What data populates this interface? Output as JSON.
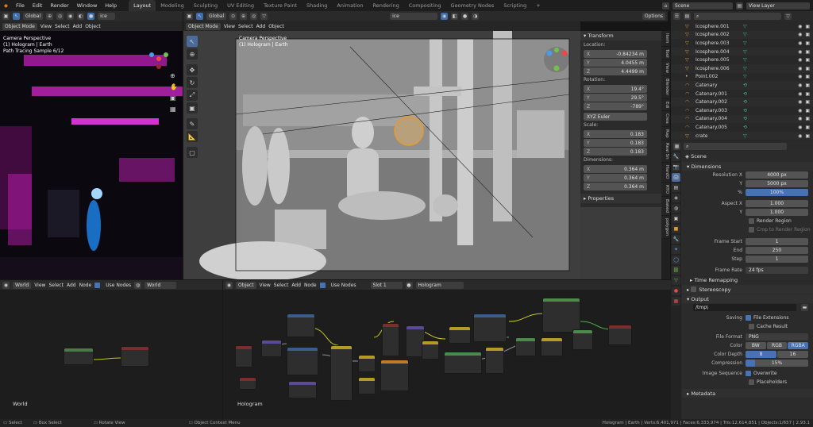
{
  "menu": [
    "File",
    "Edit",
    "Render",
    "Window",
    "Help"
  ],
  "workspaces": [
    "Layout",
    "Modeling",
    "Sculpting",
    "UV Editing",
    "Texture Paint",
    "Shading",
    "Animation",
    "Rendering",
    "Compositing",
    "Geometry Nodes",
    "Scripting"
  ],
  "active_workspace": "Layout",
  "scene_name": "Scene",
  "view_layer": "View Layer",
  "left_viewport": {
    "mode": "Object Mode",
    "menus": [
      "View",
      "Select",
      "Add",
      "Object"
    ],
    "overlay_lines": [
      "Camera Perspective",
      "(1) Hologram | Earth",
      "Path Tracing Sample 6/12"
    ],
    "search": "ice",
    "transform": "Global"
  },
  "main_viewport": {
    "mode": "Object Mode",
    "menus": [
      "View",
      "Select",
      "Add",
      "Object"
    ],
    "overlay_lines": [
      "Camera Perspective",
      "(1) Hologram | Earth"
    ],
    "transform": "Global",
    "search": "ice",
    "options": "Options"
  },
  "npanel": {
    "transform_title": "Transform",
    "location_label": "Location:",
    "location": [
      {
        "axis": "X",
        "value": "-0.84234 m"
      },
      {
        "axis": "Y",
        "value": "4.0455 m"
      },
      {
        "axis": "Z",
        "value": "4.4499 m"
      }
    ],
    "rotation_label": "Rotation:",
    "rotation": [
      {
        "axis": "X",
        "value": "19.4°"
      },
      {
        "axis": "Y",
        "value": "29.5°"
      },
      {
        "axis": "Z",
        "value": "-789°"
      }
    ],
    "rotation_mode": "XYZ Euler",
    "scale_label": "Scale:",
    "scale": [
      {
        "axis": "X",
        "value": "0.183"
      },
      {
        "axis": "Y",
        "value": "0.183"
      },
      {
        "axis": "Z",
        "value": "0.183"
      }
    ],
    "dimensions_label": "Dimensions:",
    "dimensions": [
      {
        "axis": "X",
        "value": "0.364 m"
      },
      {
        "axis": "Y",
        "value": "0.364 m"
      },
      {
        "axis": "Z",
        "value": "0.364 m"
      }
    ],
    "properties_title": "Properties",
    "tabs": [
      "Item",
      "Tool",
      "View",
      "Blender",
      "Edi",
      "Crea",
      "Rap",
      "Real Sn",
      "HardO",
      "RTO",
      "Baked",
      "polygon"
    ]
  },
  "outliner": {
    "items": [
      "Icosphere.001",
      "Icosphere.002",
      "Icosphere.003",
      "Icosphere.004",
      "Icosphere.005",
      "Icosphere.006",
      "Point.002",
      "Catenary",
      "Catenary.001",
      "Catenary.002",
      "Catenary.003",
      "Catenary.004",
      "Catenary.005",
      "crate"
    ]
  },
  "properties": {
    "scene": "Scene",
    "dimensions_title": "Dimensions",
    "res_x_label": "Resolution X",
    "res_x": "4000 px",
    "res_y_label": "Y",
    "res_y": "5000 px",
    "pct_label": "%",
    "pct": "100%",
    "aspect_x_label": "Aspect X",
    "aspect_x": "1.000",
    "aspect_y_label": "Y",
    "aspect_y": "1.000",
    "render_region": "Render Region",
    "crop": "Crop to Render Region",
    "frame_start_label": "Frame Start",
    "frame_start": "1",
    "frame_end_label": "End",
    "frame_end": "250",
    "frame_step_label": "Step",
    "frame_step": "1",
    "frame_rate_label": "Frame Rate",
    "frame_rate": "24 fps",
    "time_remap": "Time Remapping",
    "stereoscopy": "Stereoscopy",
    "output_title": "Output",
    "output_path": "/tmp\\",
    "saving_label": "Saving",
    "file_ext": "File Extensions",
    "cache_result": "Cache Result",
    "file_format_label": "File Format",
    "file_format": "PNG",
    "color_label": "Color",
    "color_opts": [
      "BW",
      "RGB",
      "RGBA"
    ],
    "color_depth_label": "Color Depth",
    "depth_opts": [
      "8",
      "16"
    ],
    "compression_label": "Compression",
    "compression": "15%",
    "image_seq_label": "Image Sequence",
    "overwrite": "Overwrite",
    "placeholders": "Placeholders",
    "metadata_title": "Metadata"
  },
  "node_world": {
    "type": "World",
    "menus": [
      "View",
      "Select",
      "Add",
      "Node"
    ],
    "use_nodes": "Use Nodes",
    "datablock": "World",
    "label": "World"
  },
  "node_obj": {
    "type": "Object",
    "menus": [
      "View",
      "Select",
      "Add",
      "Node"
    ],
    "use_nodes": "Use Nodes",
    "slot": "Slot 1",
    "material": "Hologram",
    "label": "Hologram"
  },
  "status": {
    "select": "Select",
    "box": "Box Select",
    "rotate": "Rotate View",
    "ctx": "Object Context Menu",
    "stats": "Hologram | Earth | Verts:6,401,971 | Faces:6,333,974 | Tris:12,614,851 | Objects:1/657 | 2.93.1"
  },
  "colors": {
    "accent": "#4772b3",
    "header": "#2a2a2a",
    "active_tab": "#303030"
  }
}
